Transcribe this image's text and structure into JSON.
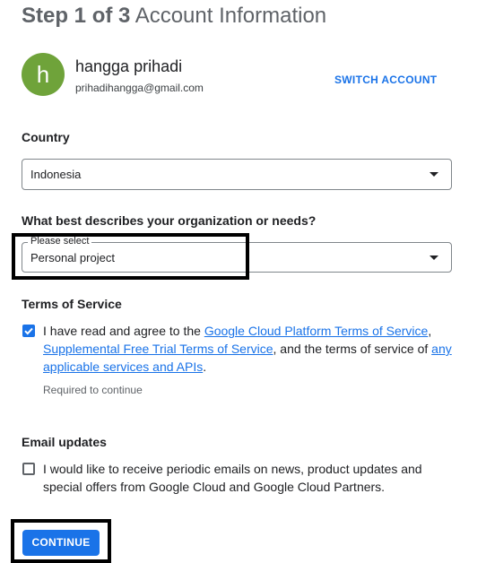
{
  "header": {
    "step_bold": "Step 1 of 3",
    "step_title": "Account Information"
  },
  "account": {
    "avatar_letter": "h",
    "avatar_color": "#6fa33a",
    "name": "hangga prihadi",
    "email": "prihadihangga@gmail.com",
    "switch_label": "SWITCH ACCOUNT"
  },
  "country": {
    "label": "Country",
    "value": "Indonesia"
  },
  "organization": {
    "label": "What best describes your organization or needs?",
    "float_label": "Please select",
    "value": "Personal project"
  },
  "terms": {
    "heading": "Terms of Service",
    "checked": true,
    "text_1": "I have read and agree to the ",
    "link_1": "Google Cloud Platform Terms of Service",
    "text_2": ", ",
    "link_2": "Supplemental Free Trial Terms of Service",
    "text_3": ", and the terms of service of ",
    "link_3": "any applicable services and APIs",
    "text_4": ".",
    "required_hint": "Required to continue"
  },
  "email_updates": {
    "heading": "Email updates",
    "checked": false,
    "text": "I would like to receive periodic emails on news, product updates and special offers from Google Cloud and Google Cloud Partners."
  },
  "actions": {
    "continue_label": "CONTINUE"
  },
  "colors": {
    "accent": "#1a73e8",
    "highlight_box": "#000000"
  }
}
